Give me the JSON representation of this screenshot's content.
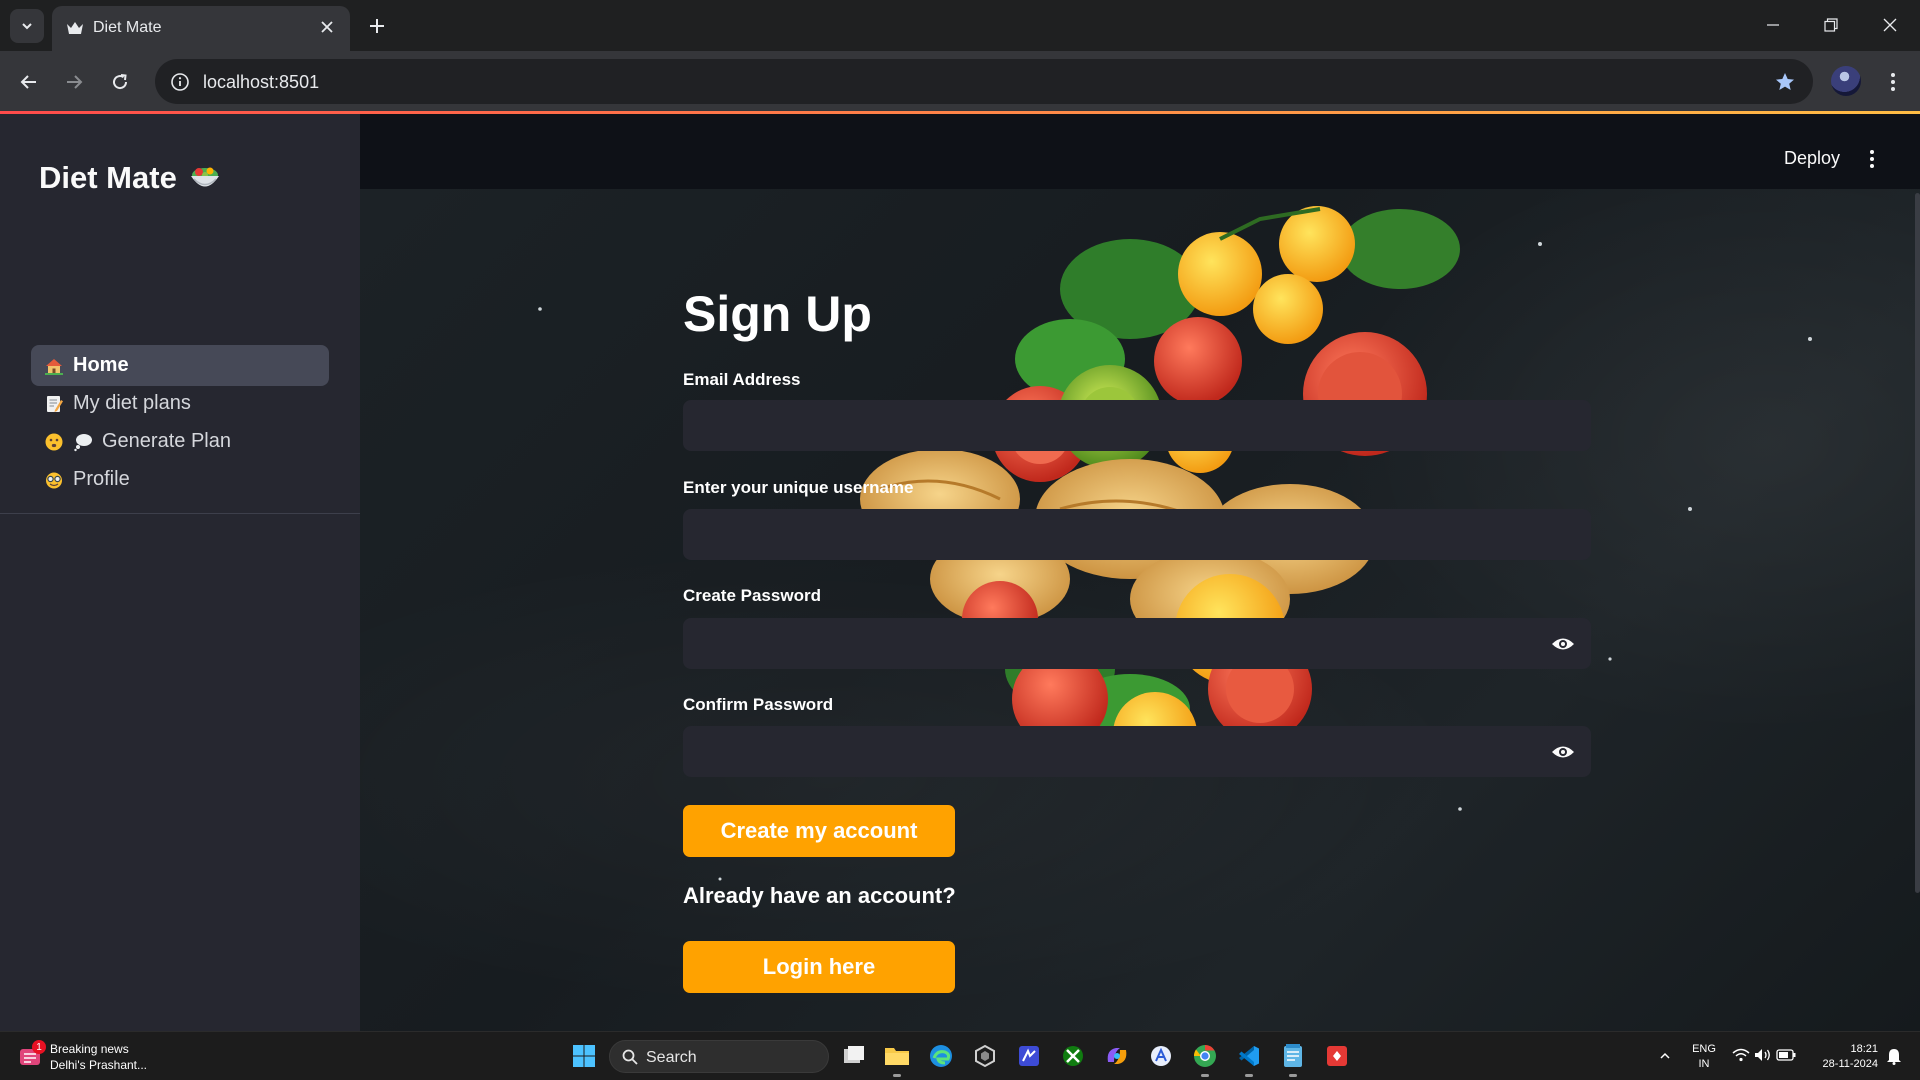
{
  "browser": {
    "tab_title": "Diet Mate",
    "url": "localhost:8501"
  },
  "sidebar": {
    "brand": "Diet Mate",
    "items": [
      {
        "label": "Home",
        "active": true
      },
      {
        "label": "My diet plans",
        "active": false
      },
      {
        "label": "Generate Plan",
        "active": false
      },
      {
        "label": "Profile",
        "active": false
      }
    ]
  },
  "header": {
    "deploy_label": "Deploy"
  },
  "form": {
    "title": "Sign Up",
    "email_label": "Email Address",
    "username_label": "Enter your unique username",
    "password_label": "Create Password",
    "confirm_label": "Confirm Password",
    "submit_label": "Create my account",
    "already_text": "Already have an account?",
    "login_label": "Login here"
  },
  "taskbar": {
    "news_title": "Breaking news",
    "news_sub": "Delhi's Prashant...",
    "news_badge": "1",
    "search_label": "Search",
    "lang_1": "ENG",
    "lang_2": "IN",
    "time": "18:21",
    "date": "28-11-2024"
  },
  "colors": {
    "accent": "#ffa200",
    "sidebar_bg": "#262730",
    "input_bg": "#262730",
    "app_bg": "#0e1117"
  }
}
